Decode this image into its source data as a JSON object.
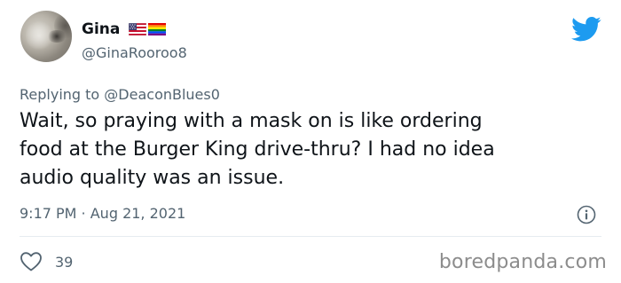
{
  "tweet": {
    "author": {
      "display_name": "Gina",
      "handle": "@GinaRooroo8",
      "flags": [
        "us-flag-icon",
        "rainbow-flag-icon"
      ]
    },
    "reply_prefix": "Replying to ",
    "reply_to": "@DeaconBlues0",
    "text_lines": [
      "Wait, so praying with a mask on is like ordering",
      "food at the Burger King drive-thru? I had no idea",
      "audio quality was an issue."
    ],
    "time": "9:17 PM",
    "separator": " · ",
    "date": "Aug 21, 2021",
    "likes": "39"
  },
  "icons": {
    "brand": "twitter-bird-icon",
    "info": "info-icon",
    "like": "heart-icon"
  },
  "colors": {
    "twitter_blue": "#1d9bf0",
    "secondary_text": "#536471",
    "primary_text": "#0f1419",
    "watermark": "#8c8c8c"
  },
  "watermark": "boredpanda.com"
}
